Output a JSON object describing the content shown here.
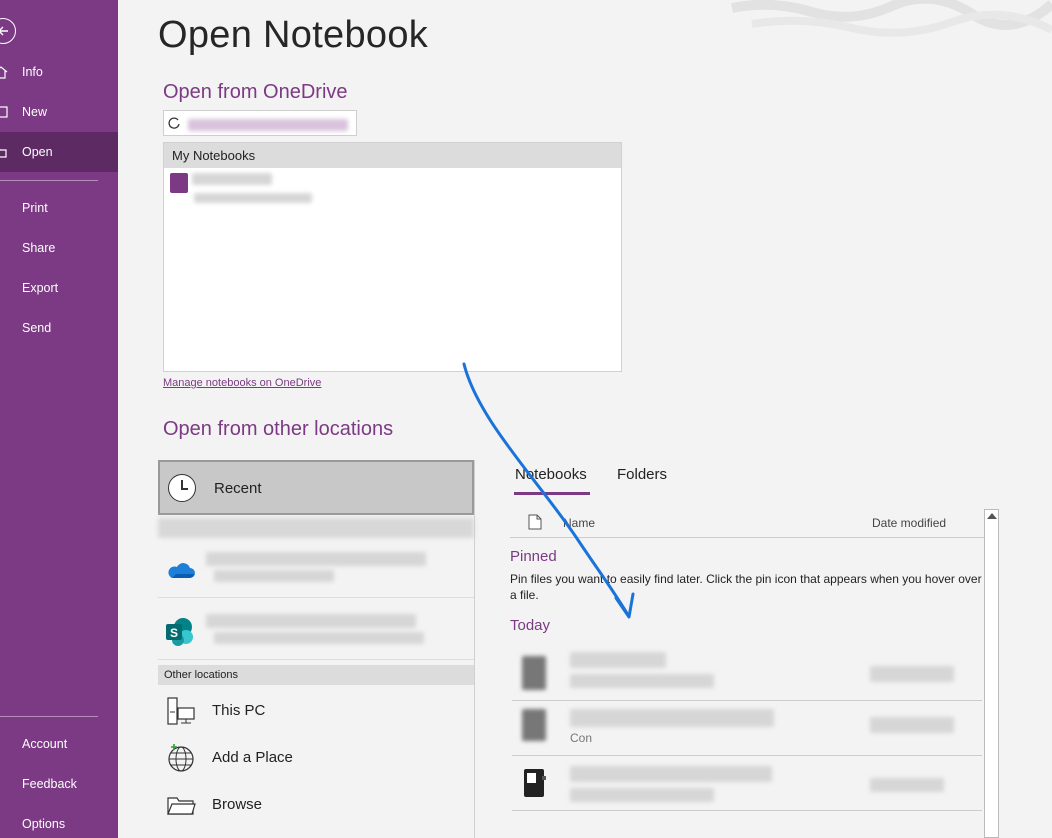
{
  "sidebar": {
    "back_icon": "back-arrow-icon",
    "items": [
      {
        "label": "Info",
        "icon": "home-icon"
      },
      {
        "label": "New",
        "icon": "new-page-icon"
      },
      {
        "label": "Open",
        "icon": "folder-open-icon"
      },
      {
        "label": "Print"
      },
      {
        "label": "Share"
      },
      {
        "label": "Export"
      },
      {
        "label": "Send"
      }
    ],
    "bottom_items": [
      {
        "label": "Account"
      },
      {
        "label": "Feedback"
      },
      {
        "label": "Options"
      }
    ],
    "colors": {
      "background": "#7b3a83",
      "active": "#5d2a64"
    }
  },
  "page": {
    "title": "Open Notebook"
  },
  "onedrive": {
    "section_title": "Open from OneDrive",
    "list_header": "My Notebooks",
    "manage_link": "Manage notebooks on OneDrive"
  },
  "other_locations": {
    "section_title": "Open from other locations",
    "recent_label": "Recent",
    "cloud_icons": [
      "onedrive-cloud-icon",
      "sharepoint-icon"
    ],
    "other_header": "Other locations",
    "items": [
      {
        "label": "This PC",
        "icon": "this-pc-icon"
      },
      {
        "label": "Add a Place",
        "icon": "globe-add-icon"
      },
      {
        "label": "Browse",
        "icon": "browse-folder-icon"
      }
    ]
  },
  "files": {
    "tabs": [
      {
        "label": "Notebooks",
        "active": true
      },
      {
        "label": "Folders",
        "active": false
      }
    ],
    "columns": {
      "name": "Name",
      "date": "Date modified"
    },
    "pinned_title": "Pinned",
    "pinned_text": "Pin files you want to easily find later. Click the pin icon that appears when you hover over a file.",
    "today_title": "Today",
    "partial_text": "Con"
  },
  "accent": "#7b3a83"
}
